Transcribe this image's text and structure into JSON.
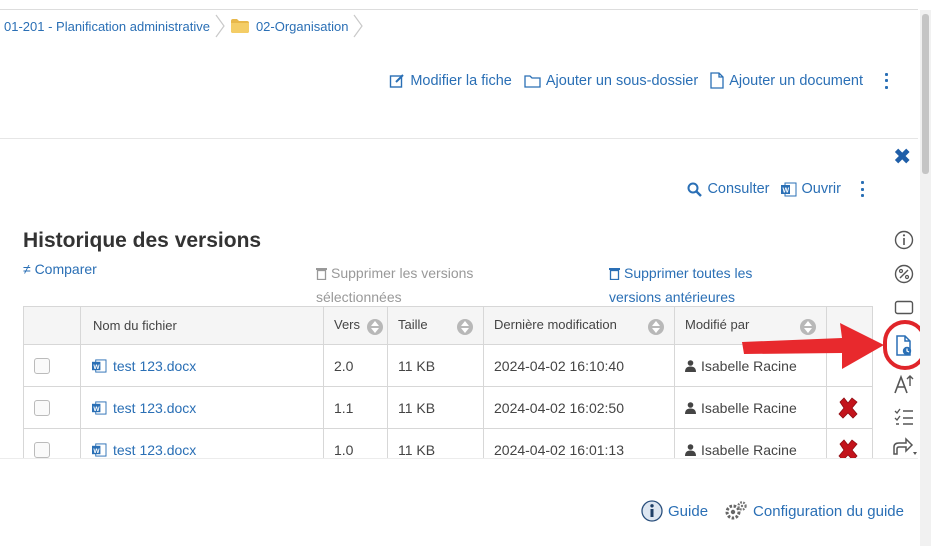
{
  "breadcrumb": {
    "items": [
      {
        "label": "01-201 - Planification administrative"
      },
      {
        "label": "02-Organisation"
      }
    ]
  },
  "folder_actions": {
    "edit": "Modifier la fiche",
    "add_subfolder": "Ajouter un sous-dossier",
    "add_document": "Ajouter un document"
  },
  "doc_actions": {
    "consult": "Consulter",
    "open": "Ouvrir"
  },
  "history": {
    "title": "Historique des versions",
    "compare": "≠ Comparer",
    "delete_selected_line1": "Supprimer les versions",
    "delete_selected_line2": "sélectionnées",
    "delete_all_line1": "Supprimer toutes les",
    "delete_all_line2": "versions antérieures",
    "columns": {
      "filename": "Nom du fichier",
      "version": "Vers",
      "size": "Taille",
      "modified": "Dernière modification",
      "modified_by": "Modifié par"
    },
    "rows": [
      {
        "filename": "test 123.docx",
        "version": "2.0",
        "size": "11 KB",
        "modified": "2024-04-02 16:10:40",
        "user": "Isabelle Racine",
        "deletable": false
      },
      {
        "filename": "test 123.docx",
        "version": "1.1",
        "size": "11 KB",
        "modified": "2024-04-02 16:02:50",
        "user": "Isabelle Racine",
        "deletable": true
      },
      {
        "filename": "test 123.docx",
        "version": "1.0",
        "size": "11 KB",
        "modified": "2024-04-02 16:01:13",
        "user": "Isabelle Racine",
        "deletable": true
      }
    ]
  },
  "footer": {
    "guide": "Guide",
    "guide_config": "Configuration du guide"
  },
  "colors": {
    "link": "#2a6fb5",
    "delete": "#c3141c",
    "annotation": "#e0252a"
  }
}
